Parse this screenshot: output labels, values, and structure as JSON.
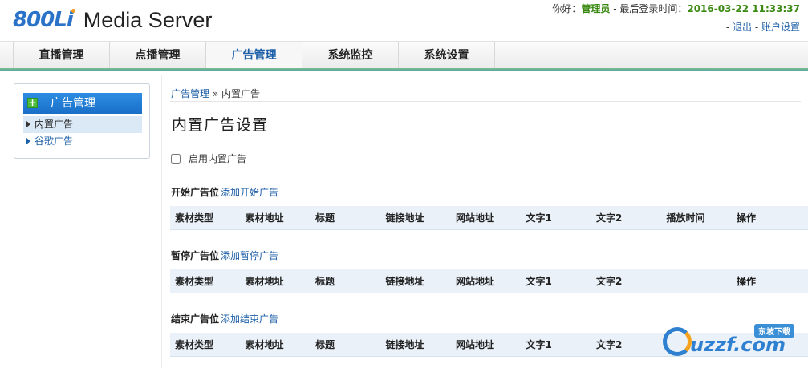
{
  "header": {
    "logo_mark": "800Li",
    "logo_title": "Media Server",
    "greeting": "你好：",
    "username": "管理员",
    "last_login_label": " - 最后登录时间：",
    "last_login_time": "2016-03-22 11:33:37",
    "logout": "退出",
    "account_settings": "账户设置"
  },
  "nav": {
    "items": [
      "直播管理",
      "点播管理",
      "广告管理",
      "系统监控",
      "系统设置"
    ],
    "active": "广告管理"
  },
  "sidebar": {
    "title": "广告管理",
    "items": [
      "内置广告",
      "谷歌广告"
    ]
  },
  "breadcrumb": {
    "parent": "广告管理",
    "sep": " » ",
    "current": "内置广告"
  },
  "page": {
    "title": "内置广告设置",
    "enable_label": "启用内置广告",
    "enable_checked": false
  },
  "sections": [
    {
      "label": "开始广告位",
      "add_link": "添加开始广告",
      "columns": [
        "素材类型",
        "素材地址",
        "标题",
        "链接地址",
        "网站地址",
        "文字1",
        "文字2",
        "播放时间",
        "操作"
      ]
    },
    {
      "label": "暂停广告位",
      "add_link": "添加暂停广告",
      "columns": [
        "素材类型",
        "素材地址",
        "标题",
        "链接地址",
        "网站地址",
        "文字1",
        "文字2",
        "",
        "操作"
      ]
    },
    {
      "label": "结束广告位",
      "add_link": "添加结束广告",
      "columns": [
        "素材类型",
        "素材地址",
        "标题",
        "链接地址",
        "网站地址",
        "文字1",
        "文字2",
        "",
        ""
      ]
    }
  ],
  "watermark": {
    "text": "uzzf.com",
    "badge": "东坡下载"
  },
  "colors": {
    "brand_blue": "#1c5fa8",
    "highlight_green": "#3a8a12",
    "table_header_bg": "#eaf1f8"
  }
}
